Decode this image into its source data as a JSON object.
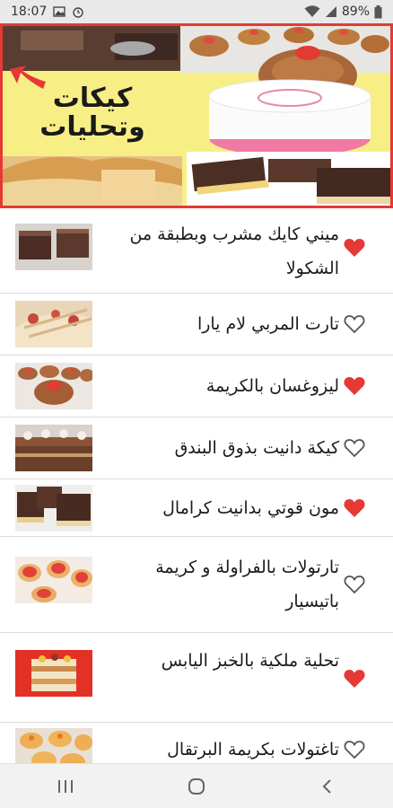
{
  "status_bar": {
    "time": "18:07",
    "battery": "89%",
    "icons": [
      "image-notification-icon",
      "alarm-icon",
      "wifi-icon",
      "signal-icon",
      "battery-icon"
    ]
  },
  "banner": {
    "title": "كيكات وتحليات",
    "line1": "كيكات",
    "line2": "وتحليات",
    "accent_color": "#e53935",
    "background_color": "#f6ee7e"
  },
  "recipes": [
    {
      "title": "ميني كايك مشرب وبطبقة من الشكولا",
      "favorite": true
    },
    {
      "title": "تارت المربي لام يارا",
      "favorite": false
    },
    {
      "title": "ليزوغسان بالكريمة",
      "favorite": true
    },
    {
      "title": "كيكة دانيت بذوق البندق",
      "favorite": false
    },
    {
      "title": "مون قوتي بدانيت كرامال",
      "favorite": true
    },
    {
      "title": "تارتولات بالفراولة و كريمة باتيسيار",
      "favorite": false
    },
    {
      "title": "تحلية ملكية بالخبز اليابس",
      "favorite": true
    },
    {
      "title": "تاغتولات بكريمة البرتقال",
      "favorite": false
    }
  ],
  "colors": {
    "heart_filled": "#e53935",
    "heart_outline": "#555555"
  },
  "nav_bar": {
    "icons": [
      "recent-apps-icon",
      "home-icon",
      "back-icon"
    ]
  }
}
